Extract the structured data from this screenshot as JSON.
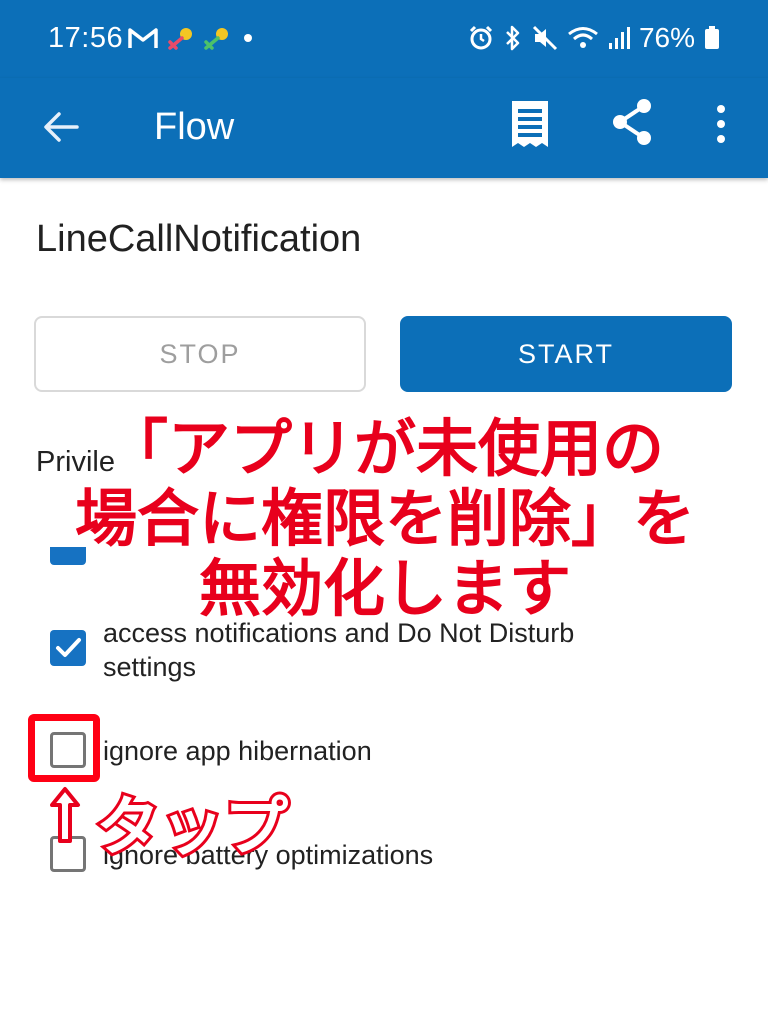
{
  "status_bar": {
    "time": "17:56",
    "battery": "76%",
    "left_icons": [
      "gmail-icon",
      "key-icon",
      "key-icon",
      "dot-icon"
    ],
    "right_icons": [
      "alarm-icon",
      "bluetooth-icon",
      "mute-icon",
      "wifi-icon",
      "signal-icon",
      "battery-icon"
    ]
  },
  "app_bar": {
    "title": "Flow",
    "actions": [
      "back-arrow-icon",
      "log-icon",
      "share-icon",
      "more-vert-icon"
    ]
  },
  "flow": {
    "name": "LineCallNotification",
    "stop_label": "STOP",
    "start_label": "START",
    "privileges_label": "Privile"
  },
  "permissions": [
    {
      "label": "access notifications and Do Not Disturb settings",
      "checked": true
    },
    {
      "label": "ignore app hibernation",
      "checked": false
    },
    {
      "label": "ignore battery optimizations",
      "checked": false
    }
  ],
  "overlay": {
    "line1": "「アプリが未使用の",
    "line2": "場合に権限を削除」を",
    "line3": "無効化します",
    "tap_label": "タップ"
  },
  "colors": {
    "primary": "#0c6fb8",
    "checkbox": "#1672c2",
    "annotation_red": "#e8001c"
  }
}
